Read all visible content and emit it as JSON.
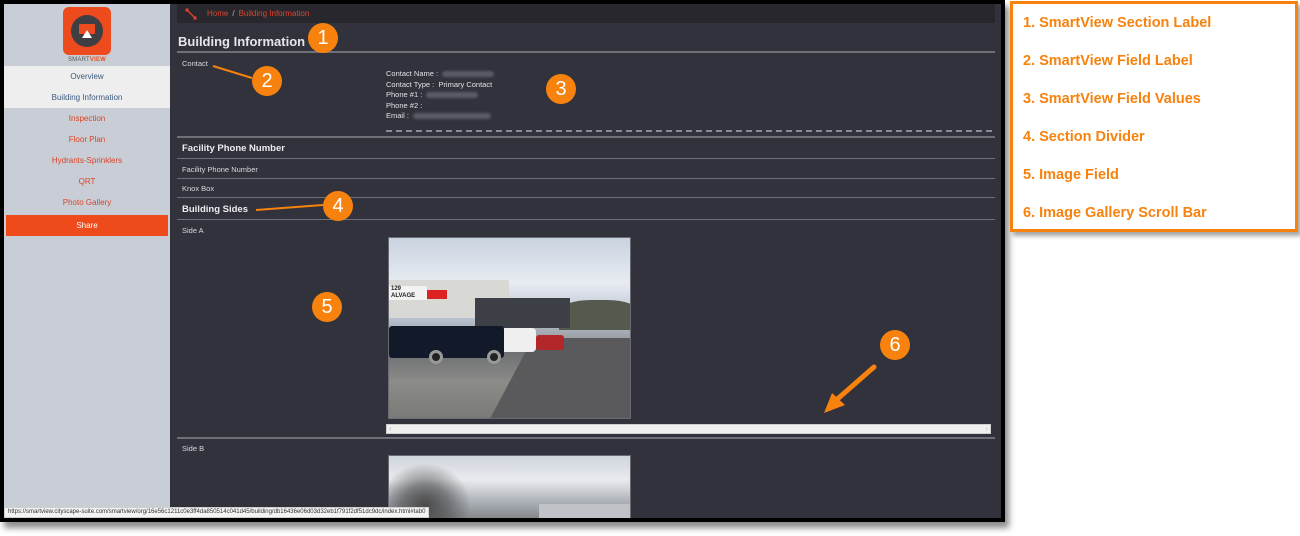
{
  "sidebar": {
    "logo_text_a": "SMART",
    "logo_text_b": "VIEW",
    "items": [
      {
        "label": "Overview",
        "state": "active"
      },
      {
        "label": "Building Information",
        "state": "active"
      },
      {
        "label": "Inspection",
        "state": "link"
      },
      {
        "label": "Floor Plan",
        "state": "link"
      },
      {
        "label": "Hydrants-Sprinklers",
        "state": "link"
      },
      {
        "label": "QRT",
        "state": "link"
      },
      {
        "label": "Photo Gallery",
        "state": "link"
      }
    ],
    "share_label": "Share"
  },
  "breadcrumb": {
    "icon": "expand-icon",
    "home": "Home",
    "separator": "/",
    "current": "Building Information"
  },
  "page": {
    "title": "Building Information",
    "contact": {
      "label": "Contact",
      "fields": [
        {
          "key": "Contact Name :",
          "value": "",
          "redacted": true
        },
        {
          "key": "Contact Type :",
          "value": "Primary Contact",
          "redacted": false
        },
        {
          "key": "Phone #1 :",
          "value": "",
          "redacted": true
        },
        {
          "key": "Phone #2 :",
          "value": "",
          "redacted": false
        },
        {
          "key": "Email :",
          "value": "",
          "redacted": true
        }
      ]
    },
    "facility_section": "Facility Phone Number",
    "facility_field": "Facility Phone Number",
    "knox_box": "Knox Box",
    "building_sides_section": "Building Sides",
    "side_a": "Side A",
    "side_b": "Side B",
    "scroll_left": "‹",
    "scroll_right": "›"
  },
  "status_url": "https://smartview.cityscape-suite.com/smartview/org/16e56c1211c0e3ff4da850514c041d45/building/db16436e06d03d32eb1f791f2df51dc9dc/index.html#tab0",
  "photo_a": {
    "sign_line1": "129",
    "sign_line2": "ALVAGE"
  },
  "callouts": [
    "1",
    "2",
    "3",
    "4",
    "5",
    "6"
  ],
  "legend": [
    "1. SmartView Section Label",
    "2. SmartView Field Label",
    "3. SmartView Field Values",
    "4. Section Divider",
    "5. Image Field",
    "6. Image Gallery Scroll Bar"
  ],
  "colors": {
    "accent": "#ed4b1d",
    "callout": "#f7820e",
    "main_bg": "#32323c",
    "sidebar_bg": "#c9cdd5"
  }
}
